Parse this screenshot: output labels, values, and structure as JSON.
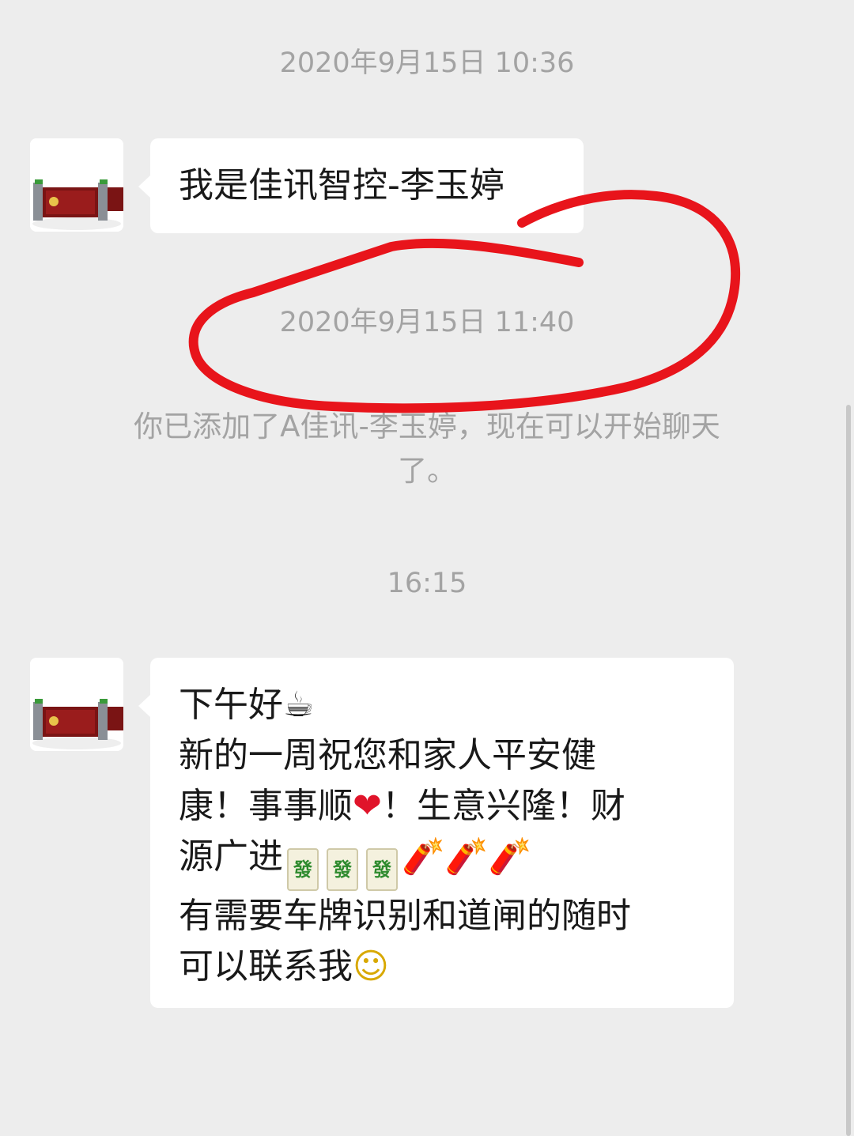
{
  "chat": {
    "timestamp_1": "2020年9月15日 10:36",
    "message_1": "我是佳讯智控-李玉婷",
    "timestamp_2": "2020年9月15日 11:40",
    "system_notice_line1": "你已添加了A佳讯-李玉婷，现在可以开始聊天",
    "system_notice_line2": "了。",
    "timestamp_3": "16:15",
    "message_2": {
      "line1": "下午好",
      "line1_emoji": "☕",
      "line2": "新的一周祝您和家人平安健",
      "line3_a": "康！事事顺",
      "line3_heart": "❤",
      "line3_b": "！生意兴隆！财",
      "line4": "源广进",
      "tile_char": "發",
      "firecracker_emoji": "🧨",
      "line5": "有需要车牌识别和道闸的随时",
      "line6": "可以联系我",
      "smile_emoji": "☺"
    }
  },
  "colors": {
    "background": "#ededed",
    "bubble": "#ffffff",
    "timestamp_text": "#a3a3a3",
    "message_text": "#191919",
    "annotation_stroke": "#e8141b"
  },
  "icons": {
    "avatar": "company-gate-logo"
  }
}
